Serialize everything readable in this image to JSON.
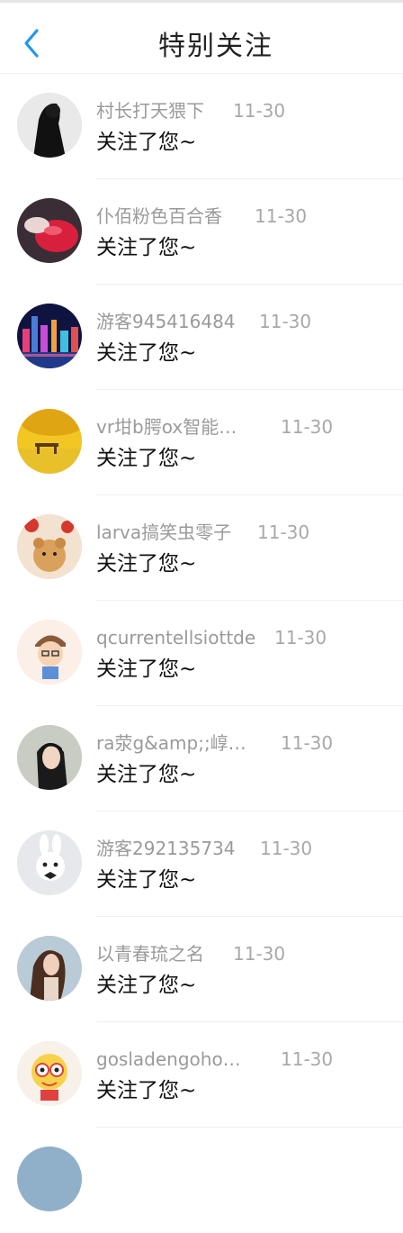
{
  "header": {
    "title": "特别关注",
    "back_icon": "chevron-left-icon",
    "accent": "#2196f3"
  },
  "notifications": [
    {
      "name": "村长打天猥下",
      "time": "11-30",
      "message": "关注了您~",
      "avatar": "person-black-icon"
    },
    {
      "name": "仆佰粉色百合香",
      "time": "11-30",
      "message": "关注了您~",
      "avatar": "red-object-icon"
    },
    {
      "name": "游客945416484",
      "time": "11-30",
      "message": "关注了您~",
      "avatar": "city-night-icon"
    },
    {
      "name": "vr坩b腭ox智能…",
      "time": "11-30",
      "message": "关注了您~",
      "avatar": "autumn-bench-icon"
    },
    {
      "name": "larva搞笑虫零子",
      "time": "11-30",
      "message": "关注了您~",
      "avatar": "teddy-bear-icon"
    },
    {
      "name": "qcurrentellsiottde",
      "time": "11-30",
      "message": "关注了您~",
      "avatar": "cartoon-boy-icon"
    },
    {
      "name": "ra荥g&amp;;崞…",
      "time": "11-30",
      "message": "关注了您~",
      "avatar": "girl-portrait-icon"
    },
    {
      "name": "游客292135734",
      "time": "11-30",
      "message": "关注了您~",
      "avatar": "snow-bunny-icon"
    },
    {
      "name": "以青春琉之名",
      "time": "11-30",
      "message": "关注了您~",
      "avatar": "woman-portrait-icon"
    },
    {
      "name": "gosladengoho…",
      "time": "11-30",
      "message": "关注了您~",
      "avatar": "cartoon-character-icon"
    }
  ]
}
